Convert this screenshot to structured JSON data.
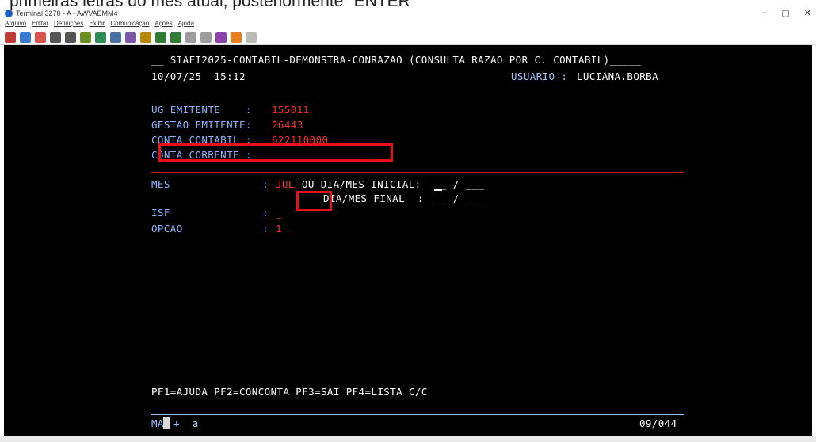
{
  "caption_text": "primeiras letras do mês atual, posteriormente \"ENTER\"",
  "window": {
    "title": "Terminal 3270 - A - AWVAEMM4",
    "controls": [
      "–",
      "▢",
      "✕"
    ]
  },
  "menu": [
    "Arquivo",
    "Editar",
    "Definições",
    "Exibir",
    "Comunicação",
    "Ações",
    "Ajuda"
  ],
  "toolbar_icons": [
    "connect-icon",
    "disconnect-icon",
    "exit-icon",
    "send-icon",
    "receive-icon",
    "copy-icon",
    "paste-icon",
    "print-icon",
    "keyboard-icon",
    "macro-icon",
    "play-icon",
    "record-icon",
    "stop-icon",
    "pause-icon",
    "link-icon",
    "upload-icon",
    "resize-icon"
  ],
  "screen": {
    "header_title": "__ SIAFI2025-CONTABIL-DEMONSTRA-CONRAZAO (CONSULTA RAZAO POR C. CONTABIL)_____",
    "datetime": "10/07/25  15:12",
    "user_label": "USUARIO :",
    "user_value": "LUCIANA.BORBA",
    "ug_label": "UG EMITENTE    :",
    "ug_value": "155011",
    "gestao_label": "GESTAO EMITENTE:",
    "gestao_value": "26443",
    "conta_label": "CONTA CONTABIL :",
    "conta_value": "622110000",
    "corrente_label": "CONTA CORRENTE :",
    "mes_label": "MES",
    "mes_sep": ":",
    "mes_value": "JUL",
    "dia_inicial_label": "OU DIA/MES INICIAL:",
    "dia_inicial_fields": "__ / ___",
    "dia_final_label": "DIA/MES FINAL  :",
    "dia_final_fields": "__ / ___",
    "isf_label": "ISF",
    "isf_sep": ":",
    "isf_value": "_",
    "opcao_label": "OPCAO",
    "opcao_sep": ":",
    "opcao_value": "1",
    "pf_keys": "PF1=AJUDA PF2=CONCONTA PF3=SAI PF4=LISTA C/C",
    "command_prompt": "MA",
    "command_rest": "+  a",
    "cursor_position": "09/044"
  },
  "colors": {
    "background": "#000000",
    "label": "#8ab4ff",
    "value": "#ff2b2b",
    "highlight": "#e8101a"
  }
}
